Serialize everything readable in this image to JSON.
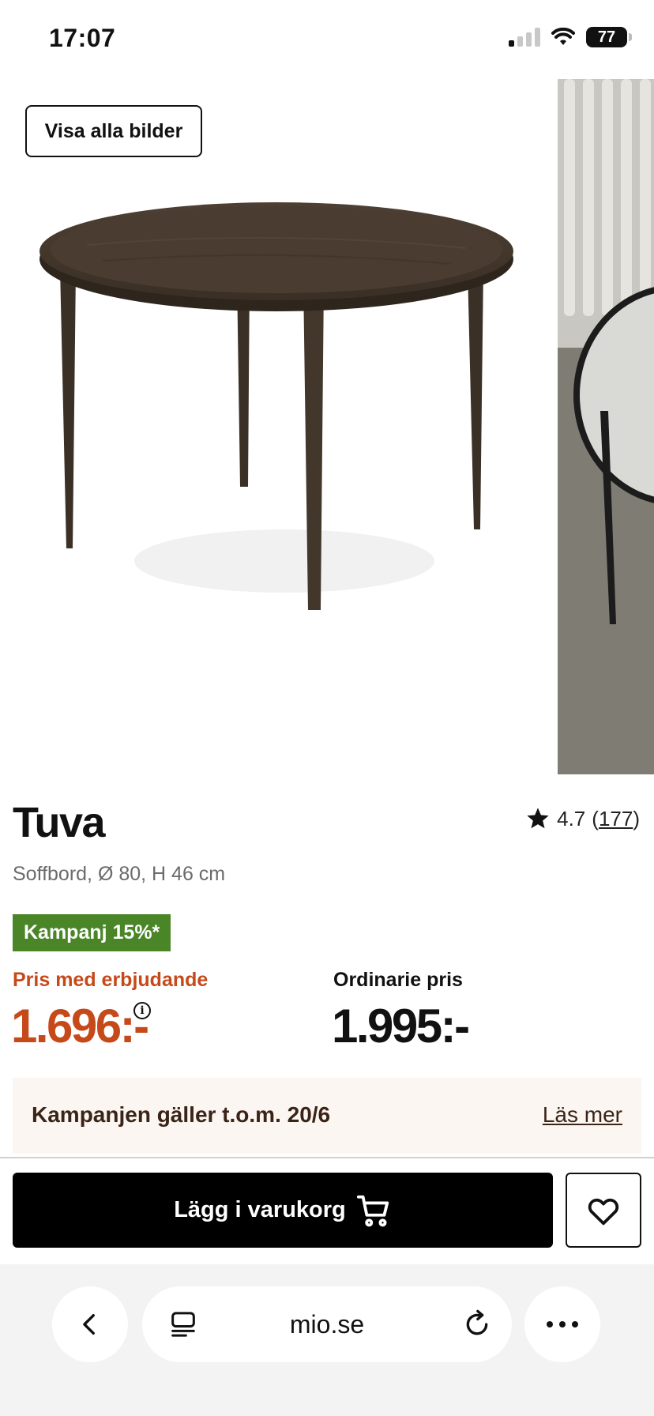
{
  "status_bar": {
    "time": "17:07",
    "battery": "77"
  },
  "gallery": {
    "show_all_label": "Visa alla bilder"
  },
  "product": {
    "name": "Tuva",
    "description": "Soffbord, Ø 80, H 46 cm",
    "rating": {
      "score": "4.7",
      "count": "177",
      "open": "(",
      "close": ")"
    },
    "campaign_badge": "Kampanj 15%*",
    "offer_label": "Pris med erbjudande",
    "offer_price": "1.696:-",
    "regular_label": "Ordinarie pris",
    "regular_price": "1.995:-"
  },
  "campaign_notice": {
    "text": "Kampanjen gäller t.o.m. 20/6",
    "link": "Läs mer"
  },
  "actions": {
    "add_to_cart": "Lägg i varukorg"
  },
  "browser": {
    "url": "mio.se"
  },
  "colors": {
    "accent_orange": "#c6491a",
    "badge_green": "#4a8628",
    "notice_bg": "#fcf6f2"
  }
}
